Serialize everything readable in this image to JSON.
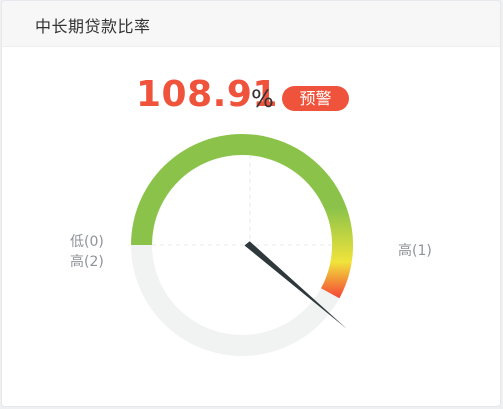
{
  "card": {
    "title": "中长期贷款比率"
  },
  "metric": {
    "value": "108.91",
    "unit": "%",
    "status_label": "预警",
    "value_color": "#f0533c",
    "status_color": "#f0533c"
  },
  "gauge": {
    "label_left_top": "低(0)",
    "label_left_bottom": "高(2)",
    "label_right": "高(1)",
    "colors": {
      "good": "#8bc34a",
      "caution": "#f1e33b",
      "alert": "#f44336",
      "track": "#f1f2f2",
      "needle": "#2f383b"
    }
  }
}
